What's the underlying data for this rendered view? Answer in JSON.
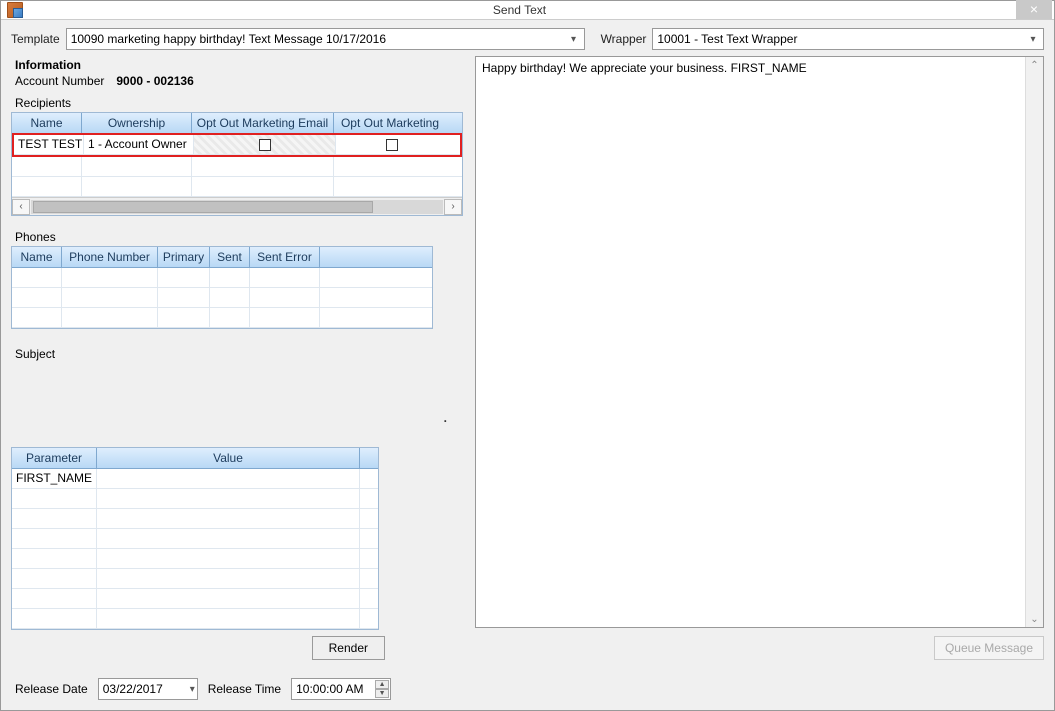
{
  "window": {
    "title": "Send Text",
    "close_glyph": "×"
  },
  "template": {
    "label": "Template",
    "value": "10090 marketing happy birthday! Text Message 10/17/2016"
  },
  "wrapper": {
    "label": "Wrapper",
    "value": "10001 - Test Text Wrapper"
  },
  "info": {
    "heading": "Information",
    "account_label": "Account Number",
    "account_value": "9000 - 002136"
  },
  "recipients": {
    "label": "Recipients",
    "columns": [
      "Name",
      "Ownership",
      "Opt Out Marketing Email",
      "Opt Out Marketing"
    ],
    "rows": [
      {
        "name": "TEST TEST",
        "ownership": "1 - Account Owner",
        "opt_email": false,
        "opt_mkt": false
      }
    ]
  },
  "phones": {
    "label": "Phones",
    "columns": [
      "Name",
      "Phone Number",
      "Primary",
      "Sent",
      "Sent Error"
    ]
  },
  "subject": {
    "label": "Subject",
    "value": ""
  },
  "params": {
    "columns": [
      "Parameter",
      "Value"
    ],
    "rows": [
      {
        "param": "FIRST_NAME",
        "value": ""
      }
    ]
  },
  "render": {
    "label": "Render"
  },
  "release": {
    "date_label": "Release Date",
    "date_value": "03/22/2017",
    "time_label": "Release Time",
    "time_value": "10:00:00 AM"
  },
  "message": {
    "text": "Happy birthday! We appreciate your business. FIRST_NAME"
  },
  "queue": {
    "label": "Queue Message"
  }
}
